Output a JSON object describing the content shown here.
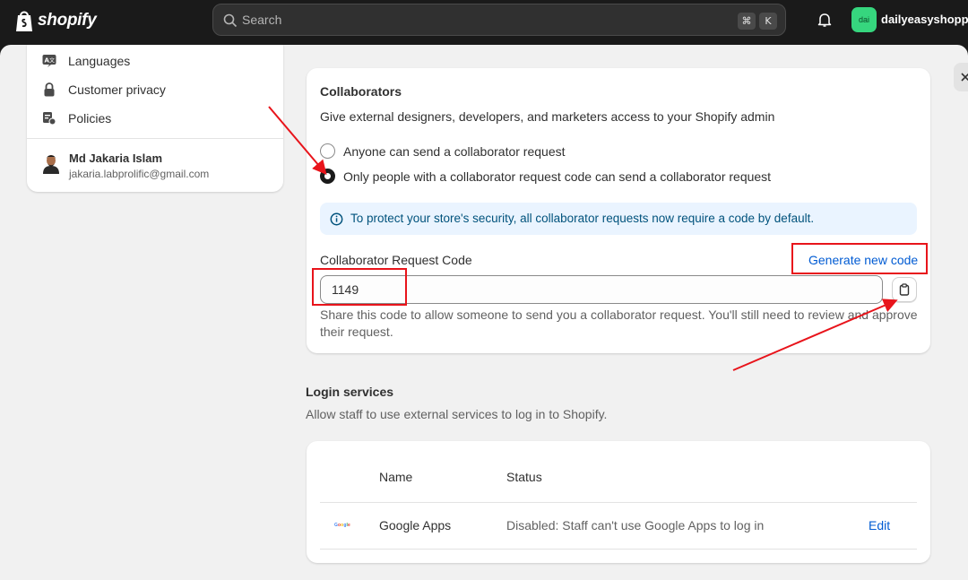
{
  "topbar": {
    "brand": "shopify",
    "search_placeholder": "Search",
    "shortcut_keys": [
      "⌘",
      "K"
    ],
    "store_avatar": "dai",
    "store_name": "dailyeasyshoppin"
  },
  "sidebar": {
    "items": [
      {
        "label": "Languages",
        "icon": "translate-icon"
      },
      {
        "label": "Customer privacy",
        "icon": "lock-icon"
      },
      {
        "label": "Policies",
        "icon": "policy-icon"
      }
    ],
    "user": {
      "name": "Md Jakaria Islam",
      "email": "jakaria.labprolific@gmail.com"
    }
  },
  "collaborators": {
    "title": "Collaborators",
    "description": "Give external designers, developers, and marketers access to your Shopify admin",
    "options": [
      {
        "label": "Anyone can send a collaborator request",
        "checked": false
      },
      {
        "label": "Only people with a collaborator request code can send a collaborator request",
        "checked": true
      }
    ],
    "banner": "To protect your store's security, all collaborator requests now require a code by default.",
    "code_label": "Collaborator Request Code",
    "generate_link": "Generate new code",
    "code_value": "1149",
    "help_text": "Share this code to allow someone to send you a collaborator request. You'll still need to review and approve their request."
  },
  "login_services": {
    "title": "Login services",
    "description": "Allow staff to use external services to log in to Shopify.",
    "columns": [
      "Name",
      "Status"
    ],
    "rows": [
      {
        "logo": "Google",
        "name": "Google Apps",
        "status": "Disabled: Staff can't use Google Apps to log in",
        "action": "Edit"
      }
    ]
  },
  "colors": {
    "annotation": "#e8141b",
    "link": "#005bd3",
    "banner_bg": "#eaf4ff"
  }
}
